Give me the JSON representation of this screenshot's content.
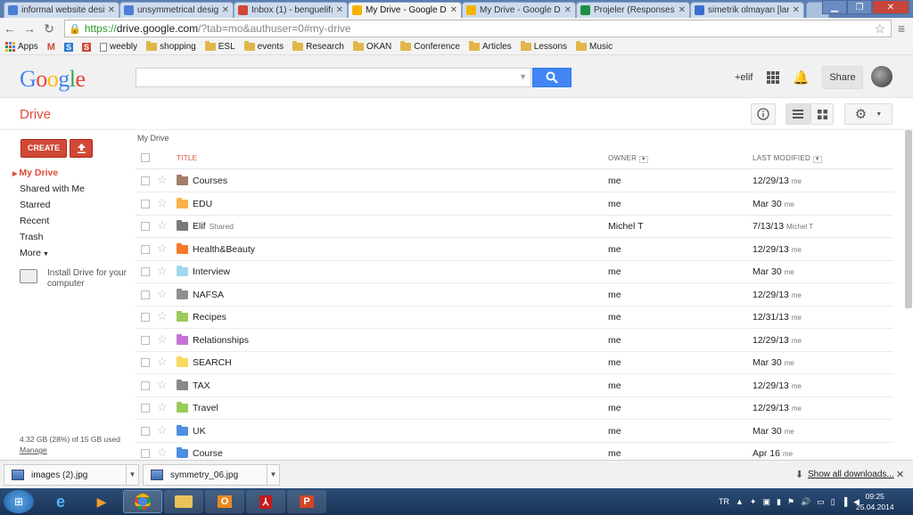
{
  "browser": {
    "tabs": [
      {
        "label": "informal website desi",
        "favicon_color": "#4a7fd4"
      },
      {
        "label": "unsymmetrical desig",
        "favicon_color": "#4a7fd4"
      },
      {
        "label": "Inbox (1) - benguelif@",
        "favicon_color": "#d14836"
      },
      {
        "label": "My Drive - Google Dr",
        "favicon_color": "#f4b400"
      },
      {
        "label": "My Drive - Google Dr",
        "favicon_color": "#f4b400"
      },
      {
        "label": "Projeler (Responses)",
        "favicon_color": "#1e8e3e"
      },
      {
        "label": "simetrik olmayan [lar",
        "favicon_color": "#3a6fcf"
      }
    ],
    "url_scheme": "https://",
    "url_host": "drive.google.com",
    "url_rest": "/?tab=mo&authuser=0#my-drive",
    "bookmarks": [
      "Apps",
      "",
      "",
      "",
      "weebly",
      "shopping",
      "ESL",
      "events",
      "Research",
      "OKAN",
      "Conference",
      "Articles",
      "Lessons",
      "Music"
    ]
  },
  "header": {
    "logo": "Google",
    "user_label": "+elif",
    "share_label": "Share"
  },
  "drive": {
    "title": "Drive",
    "create_label": "CREATE"
  },
  "sidebar": {
    "items": [
      "My Drive",
      "Shared with Me",
      "Starred",
      "Recent",
      "Trash",
      "More"
    ],
    "install_text": "Install Drive for your computer",
    "quota": "4.32 GB (28%) of 15 GB used",
    "manage": "Manage"
  },
  "content": {
    "breadcrumb": "My Drive",
    "columns": {
      "title": "TITLE",
      "owner": "OWNER",
      "modified": "LAST MODIFIED"
    },
    "rows": [
      {
        "name": "Courses",
        "shared": "",
        "owner": "me",
        "date": "12/29/13",
        "by": "me",
        "color": "#a47d6a"
      },
      {
        "name": "EDU",
        "shared": "",
        "owner": "me",
        "date": "Mar 30",
        "by": "me",
        "color": "#f9b24a"
      },
      {
        "name": "Elif",
        "shared": "Shared",
        "owner": "Michel T",
        "date": "7/13/13",
        "by": "Michel T",
        "color": "#7a7a7a"
      },
      {
        "name": "Health&Beauty",
        "shared": "",
        "owner": "me",
        "date": "12/29/13",
        "by": "me",
        "color": "#f4792a"
      },
      {
        "name": "Interview",
        "shared": "",
        "owner": "me",
        "date": "Mar 30",
        "by": "me",
        "color": "#9fd7ec"
      },
      {
        "name": "NAFSA",
        "shared": "",
        "owner": "me",
        "date": "12/29/13",
        "by": "me",
        "color": "#8f8f8f"
      },
      {
        "name": "Recipes",
        "shared": "",
        "owner": "me",
        "date": "12/31/13",
        "by": "me",
        "color": "#9bcb5a"
      },
      {
        "name": "Relationships",
        "shared": "",
        "owner": "me",
        "date": "12/29/13",
        "by": "me",
        "color": "#c673d6"
      },
      {
        "name": "SEARCH",
        "shared": "",
        "owner": "me",
        "date": "Mar 30",
        "by": "me",
        "color": "#f9d85e"
      },
      {
        "name": "TAX",
        "shared": "",
        "owner": "me",
        "date": "12/29/13",
        "by": "me",
        "color": "#8a8a8a"
      },
      {
        "name": "Travel",
        "shared": "",
        "owner": "me",
        "date": "12/29/13",
        "by": "me",
        "color": "#9bcb5a"
      },
      {
        "name": "UK",
        "shared": "",
        "owner": "me",
        "date": "Mar 30",
        "by": "me",
        "color": "#4d8fe0"
      },
      {
        "name": "Course",
        "shared": "",
        "owner": "me",
        "date": "Apr 16",
        "by": "me",
        "color": "#4d8fe0"
      }
    ]
  },
  "downloads": {
    "items": [
      "images (2).jpg",
      "symmetry_06.jpg"
    ],
    "show_all": "Show all downloads..."
  },
  "taskbar": {
    "lang": "TR",
    "time": "09:25",
    "date": "25.04.2014"
  },
  "icons": {
    "back": "arrow-left",
    "forward": "arrow-right",
    "reload": "reload",
    "search": "magnifier",
    "bell": "bell",
    "info": "info-circle",
    "list_view": "list",
    "grid_view": "grid",
    "settings": "gear",
    "upload": "upload-arrow"
  }
}
